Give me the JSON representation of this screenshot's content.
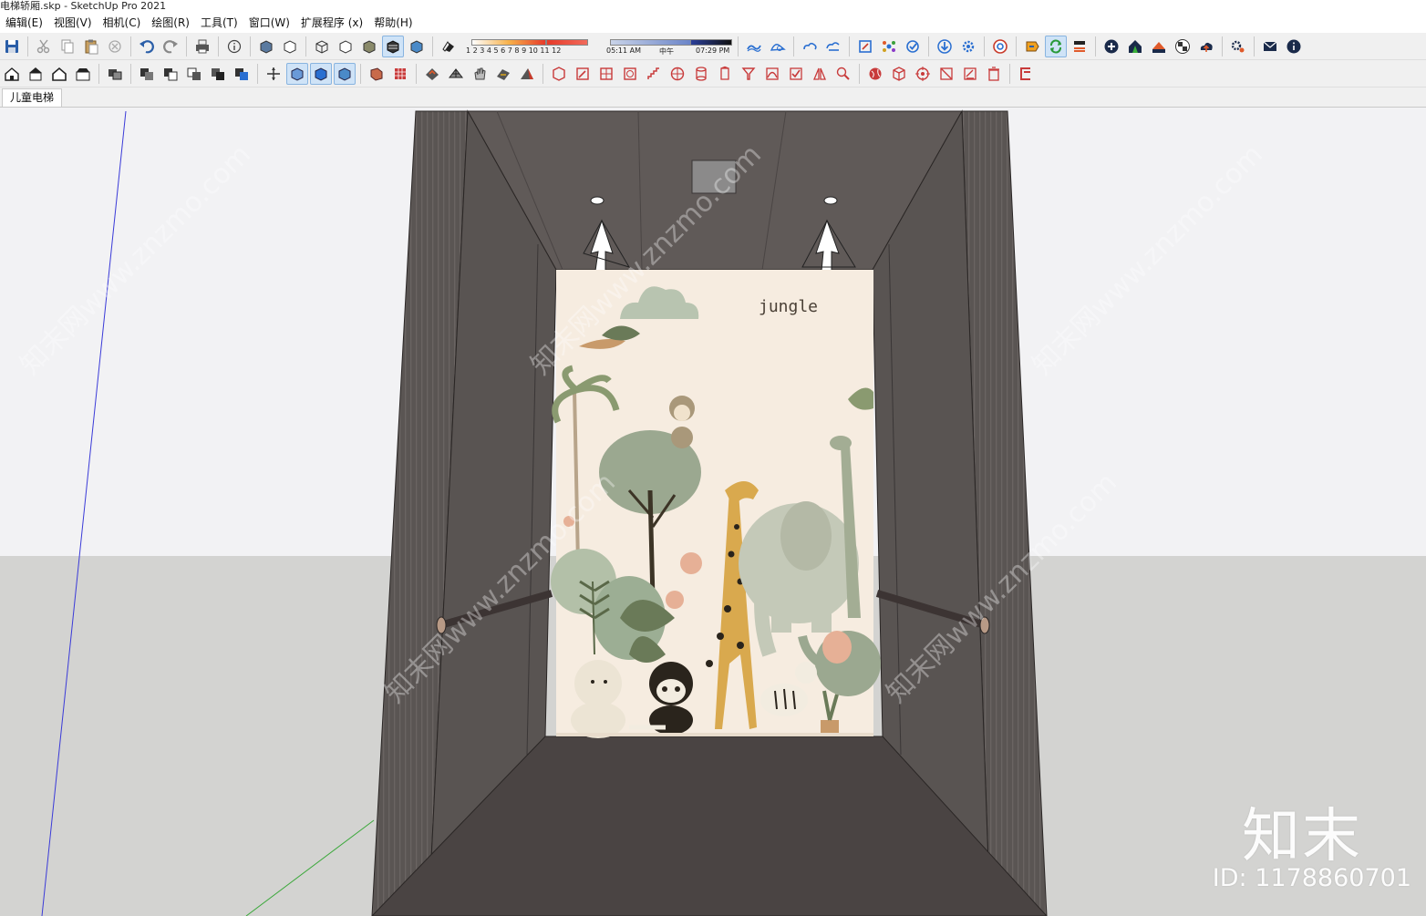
{
  "window": {
    "title": "电梯轿厢.skp - SketchUp Pro 2021"
  },
  "menu": [
    "编辑(E)",
    "视图(V)",
    "相机(C)",
    "绘图(R)",
    "工具(T)",
    "窗口(W)",
    "扩展程序 (x)",
    "帮助(H)"
  ],
  "shadow": {
    "months": "1 2 3 4 5 6 7 8 9 10 11 12",
    "time_start": "05:11 AM",
    "time_mid": "中午",
    "time_end": "07:29 PM"
  },
  "tabs": [
    {
      "label": "儿童电梯",
      "active": true
    }
  ],
  "scene": {
    "mural_title": "jungle",
    "sky_color": "#ffffff",
    "ground_color": "#d3d3d1",
    "wall_color": "#5b5553",
    "mural_bg": "#f6ece0"
  },
  "watermark": {
    "logo": "知末",
    "id_text": "ID: 1178860701",
    "diagonal": "知末网www.znzmo.com"
  },
  "colors": {
    "accent": "#2a6fd1",
    "selected_bg": "#cfe3f7"
  }
}
